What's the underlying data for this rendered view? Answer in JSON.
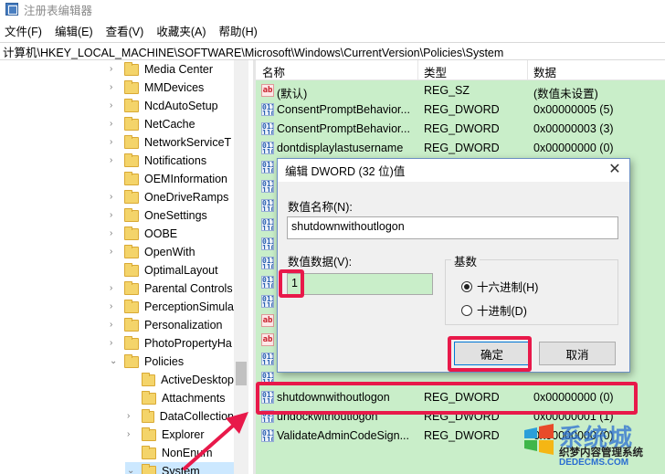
{
  "window": {
    "title": "注册表编辑器"
  },
  "menu": [
    "文件(F)",
    "编辑(E)",
    "查看(V)",
    "收藏夹(A)",
    "帮助(H)"
  ],
  "address": "计算机\\HKEY_LOCAL_MACHINE\\SOFTWARE\\Microsoft\\Windows\\CurrentVersion\\Policies\\System",
  "tree": {
    "items": [
      {
        "label": "Media Center",
        "level": 0,
        "expander": "collapsed"
      },
      {
        "label": "MMDevices",
        "level": 0,
        "expander": "collapsed"
      },
      {
        "label": "NcdAutoSetup",
        "level": 0,
        "expander": "collapsed"
      },
      {
        "label": "NetCache",
        "level": 0,
        "expander": "collapsed"
      },
      {
        "label": "NetworkServiceT",
        "level": 0,
        "expander": "collapsed"
      },
      {
        "label": "Notifications",
        "level": 0,
        "expander": "collapsed"
      },
      {
        "label": "OEMInformation",
        "level": 0,
        "expander": "none"
      },
      {
        "label": "OneDriveRamps",
        "level": 0,
        "expander": "collapsed"
      },
      {
        "label": "OneSettings",
        "level": 0,
        "expander": "collapsed"
      },
      {
        "label": "OOBE",
        "level": 0,
        "expander": "collapsed"
      },
      {
        "label": "OpenWith",
        "level": 0,
        "expander": "collapsed"
      },
      {
        "label": "OptimalLayout",
        "level": 0,
        "expander": "none"
      },
      {
        "label": "Parental Controls",
        "level": 0,
        "expander": "collapsed"
      },
      {
        "label": "PerceptionSimula",
        "level": 0,
        "expander": "collapsed"
      },
      {
        "label": "Personalization",
        "level": 0,
        "expander": "collapsed"
      },
      {
        "label": "PhotoPropertyHa",
        "level": 0,
        "expander": "collapsed"
      },
      {
        "label": "Policies",
        "level": 0,
        "expander": "expanded"
      },
      {
        "label": "ActiveDesktop",
        "level": 1,
        "expander": "none"
      },
      {
        "label": "Attachments",
        "level": 1,
        "expander": "none"
      },
      {
        "label": "DataCollection",
        "level": 1,
        "expander": "collapsed"
      },
      {
        "label": "Explorer",
        "level": 1,
        "expander": "collapsed"
      },
      {
        "label": "NonEnum",
        "level": 1,
        "expander": "none"
      },
      {
        "label": "System",
        "level": 1,
        "expander": "expanded",
        "selected": true
      }
    ]
  },
  "list": {
    "headers": {
      "name": "名称",
      "type": "类型",
      "data": "数据"
    },
    "rows": [
      {
        "icon": "ab",
        "name": "(默认)",
        "type": "REG_SZ",
        "data": "(数值未设置)"
      },
      {
        "icon": "dw",
        "name": "ConsentPromptBehavior...",
        "type": "REG_DWORD",
        "data": "0x00000005 (5)"
      },
      {
        "icon": "dw",
        "name": "ConsentPromptBehavior...",
        "type": "REG_DWORD",
        "data": "0x00000003 (3)"
      },
      {
        "icon": "dw",
        "name": "dontdisplaylastusername",
        "type": "REG_DWORD",
        "data": "0x00000000 (0)"
      },
      {
        "icon": "dw",
        "name": "",
        "type": "",
        "data": ""
      },
      {
        "icon": "dw",
        "name": "",
        "type": "",
        "data": ""
      },
      {
        "icon": "dw",
        "name": "",
        "type": "",
        "data": ""
      },
      {
        "icon": "dw",
        "name": "",
        "type": "",
        "data": ""
      },
      {
        "icon": "dw",
        "name": "",
        "type": "",
        "data": ""
      },
      {
        "icon": "dw",
        "name": "",
        "type": "",
        "data": ""
      },
      {
        "icon": "dw",
        "name": "",
        "type": "",
        "data": ""
      },
      {
        "icon": "dw",
        "name": "",
        "type": "",
        "data": ""
      },
      {
        "icon": "ab",
        "name": "",
        "type": "",
        "data": ""
      },
      {
        "icon": "ab",
        "name": "",
        "type": "",
        "data": ""
      },
      {
        "icon": "dw",
        "name": "",
        "type": "",
        "data": ""
      },
      {
        "icon": "dw",
        "name": "",
        "type": "",
        "data": ""
      },
      {
        "icon": "dw",
        "name": "shutdownwithoutlogon",
        "type": "REG_DWORD",
        "data": "0x00000000 (0)"
      },
      {
        "icon": "dw",
        "name": "undockwithoutlogon",
        "type": "REG_DWORD",
        "data": "0x00000001 (1)"
      },
      {
        "icon": "dw",
        "name": "ValidateAdminCodeSign...",
        "type": "REG_DWORD",
        "data": "0x00000000 (0)"
      }
    ]
  },
  "dialog": {
    "title": "编辑 DWORD (32 位)值",
    "value_name_label": "数值名称(N):",
    "value_name": "shutdownwithoutlogon",
    "value_data_label": "数值数据(V):",
    "value_data": "1",
    "base_label": "基数",
    "radio_hex": "十六进制(H)",
    "radio_dec": "十进制(D)",
    "ok": "确定",
    "cancel": "取消",
    "close_glyph": "✕"
  },
  "watermark": {
    "big": "系统城",
    "sub": "织梦内容管理系统",
    "url": "DEDECMS.COM"
  },
  "colors": {
    "highlight": "#e8194a",
    "list_bg": "#c9eec9",
    "selected": "#cce8ff"
  }
}
